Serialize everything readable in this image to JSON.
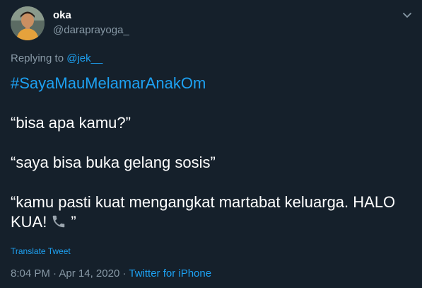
{
  "user": {
    "display_name": "oka",
    "handle": "@daraprayoga_"
  },
  "reply": {
    "prefix": "Replying to ",
    "mention": "@jek__"
  },
  "tweet": {
    "hashtag": "#SayaMauMelamarAnakOm",
    "line1": "“bisa apa kamu?”",
    "line2": "“saya bisa buka gelang sosis”",
    "line3a": "“kamu pasti kuat mengangkat martabat keluarga. HALO",
    "line3b_start": "KUA!",
    "line3b_end": "”",
    "emoji_icon": "phone-receiver-icon"
  },
  "translate_label": "Translate Tweet",
  "meta": {
    "time": "8:04 PM",
    "separator": " · ",
    "date": "Apr 14, 2020",
    "source": "Twitter for iPhone"
  },
  "colors": {
    "background": "#15202b",
    "text": "#ffffff",
    "secondary": "#8899a6",
    "link": "#1da1f2"
  }
}
